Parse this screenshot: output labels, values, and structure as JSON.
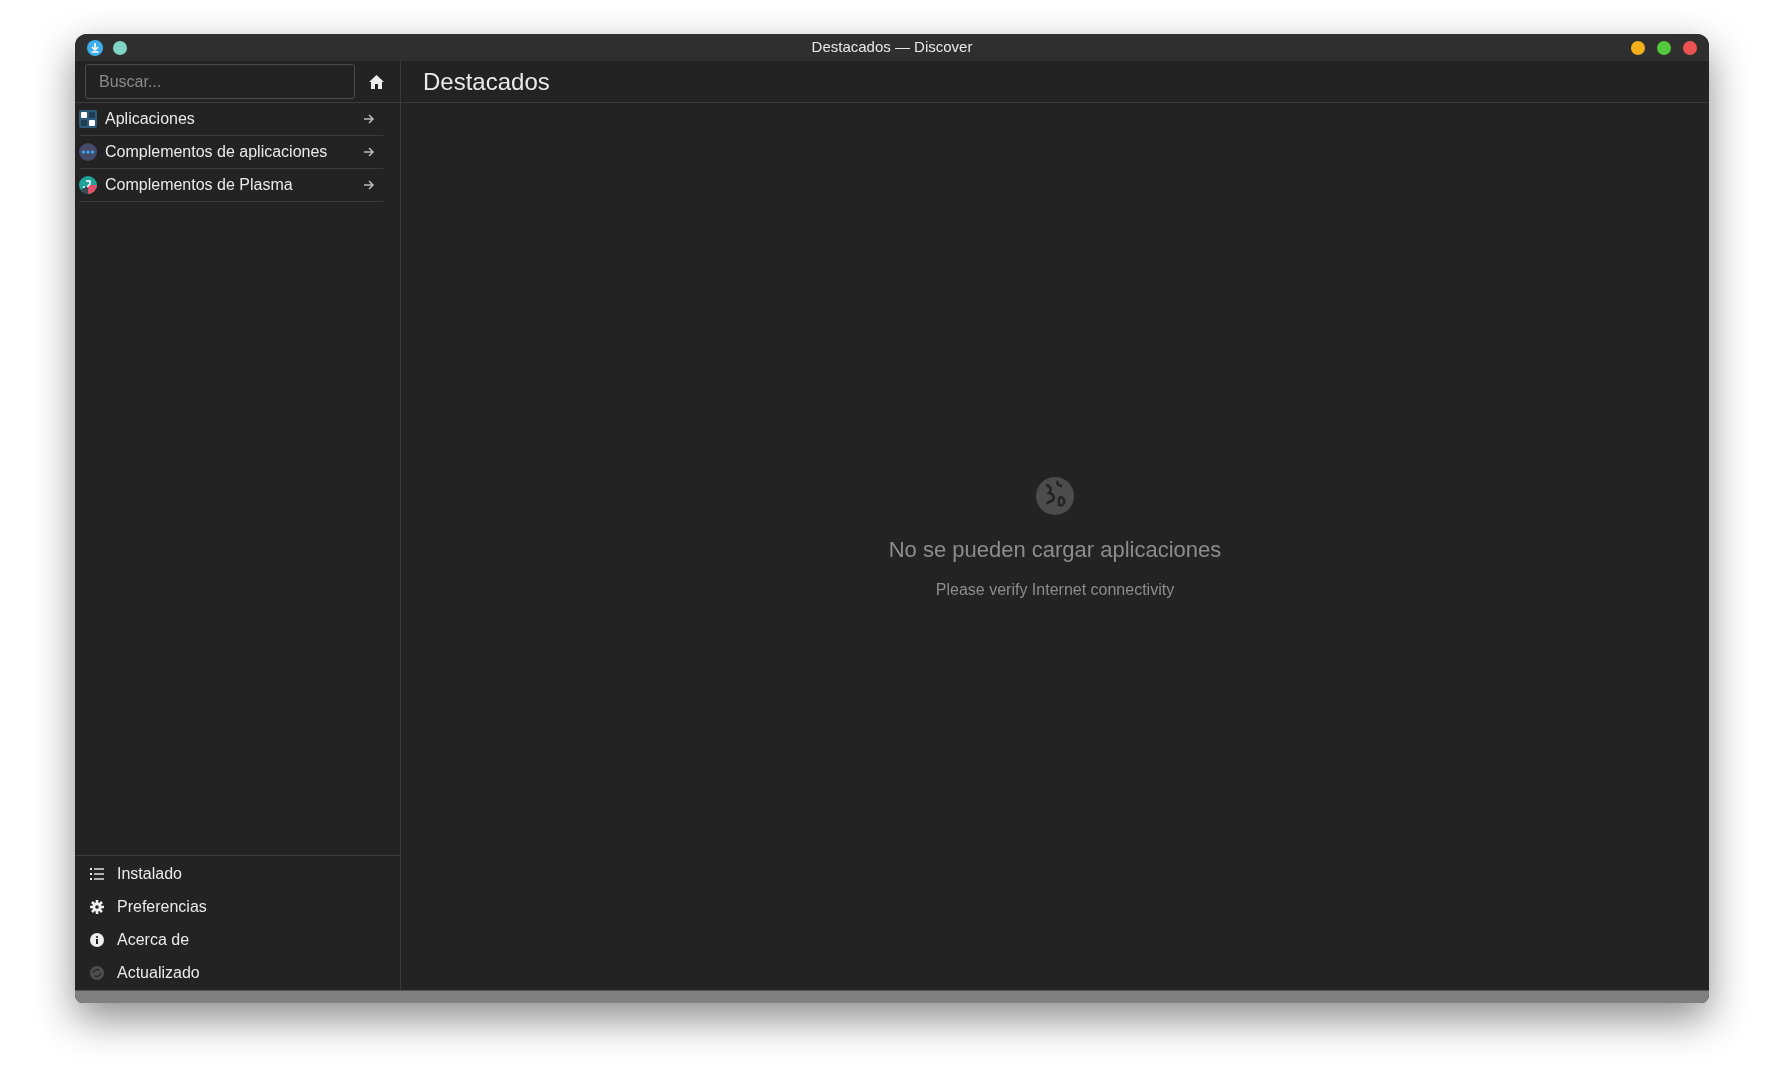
{
  "window": {
    "title": "Destacados — Discover"
  },
  "sidebar": {
    "search": {
      "placeholder": "Buscar..."
    },
    "categories": [
      {
        "label": "Aplicaciones"
      },
      {
        "label": "Complementos de aplicaciones"
      },
      {
        "label": "Complementos de Plasma"
      }
    ],
    "footer_items": [
      {
        "label": "Instalado"
      },
      {
        "label": "Preferencias"
      },
      {
        "label": "Acerca de"
      },
      {
        "label": "Actualizado"
      }
    ]
  },
  "main": {
    "heading": "Destacados",
    "empty_state": {
      "title": "No se pueden cargar aplicaciones",
      "message": "Please verify Internet connectivity"
    }
  }
}
